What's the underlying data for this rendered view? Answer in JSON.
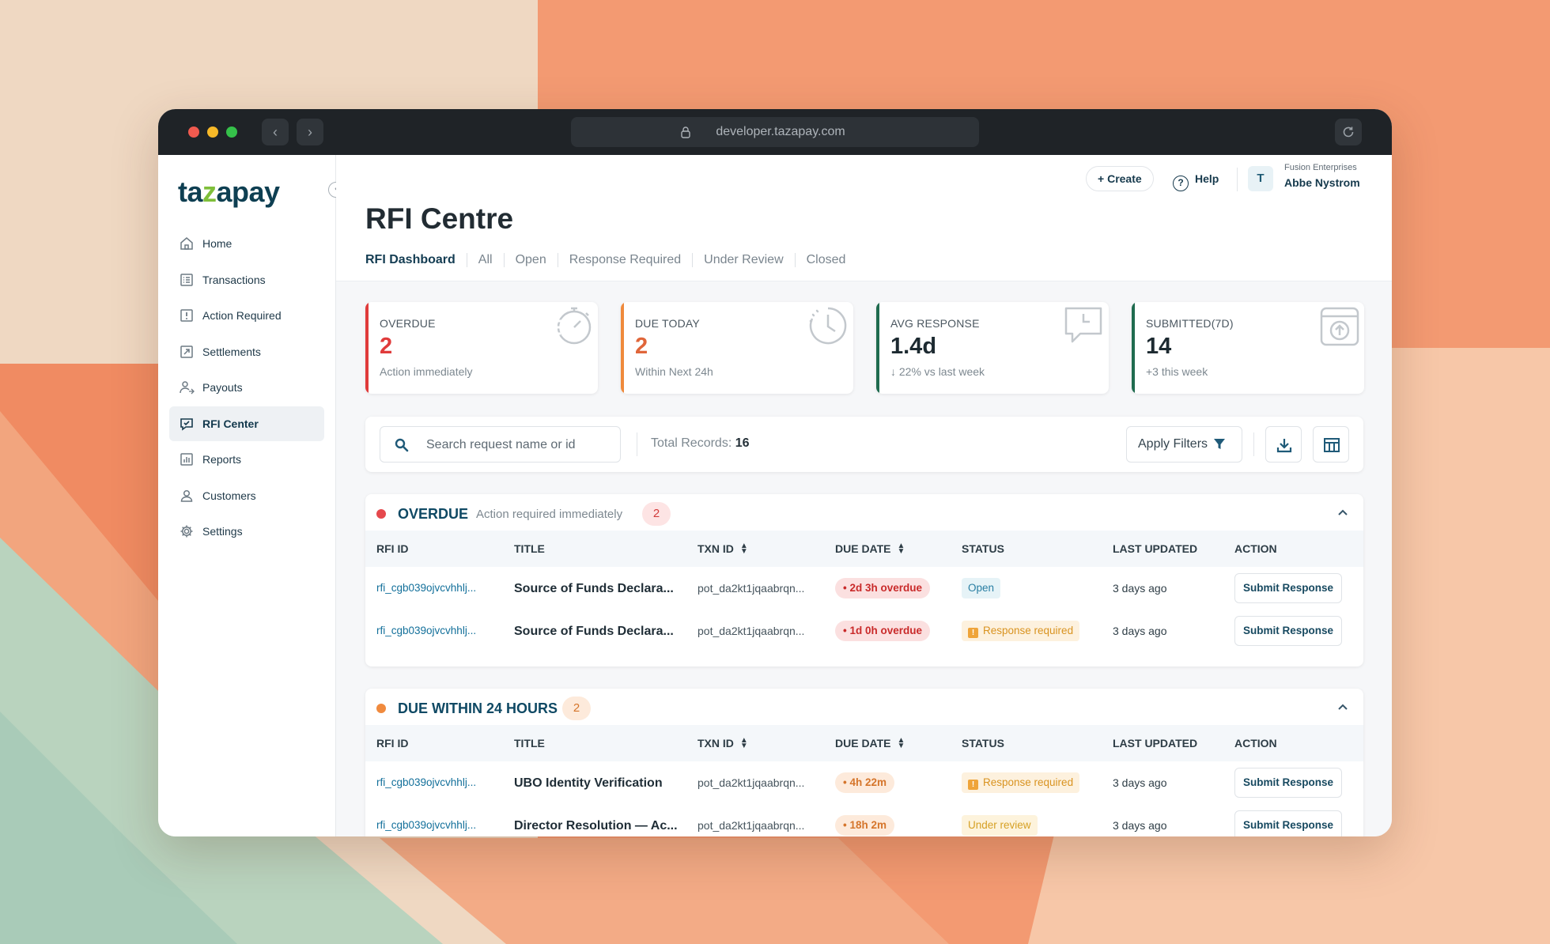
{
  "browser": {
    "url": "developer.tazapay.com"
  },
  "sidebar": {
    "logo": {
      "pre": "ta",
      "z": "z",
      "post": "apay"
    },
    "items": [
      {
        "label": "Home",
        "icon": "home-icon",
        "active": false
      },
      {
        "label": "Transactions",
        "icon": "list-icon",
        "active": false
      },
      {
        "label": "Action Required",
        "icon": "alert-square-icon",
        "active": false
      },
      {
        "label": "Settlements",
        "icon": "arrow-square-icon",
        "active": false
      },
      {
        "label": "Payouts",
        "icon": "user-transfer-icon",
        "active": false
      },
      {
        "label": "RFI Center",
        "icon": "chat-check-icon",
        "active": true
      },
      {
        "label": "Reports",
        "icon": "bar-chart-icon",
        "active": false
      },
      {
        "label": "Customers",
        "icon": "user-icon",
        "active": false
      },
      {
        "label": "Settings",
        "icon": "gear-icon",
        "active": false
      }
    ]
  },
  "topbar": {
    "create_label": "Create",
    "help_label": "Help",
    "avatar_initial": "T",
    "company": "Fusion Enterprises",
    "user": "Abbe Nystrom"
  },
  "page": {
    "title": "RFI Centre",
    "tabs": [
      "RFI Dashboard",
      "All",
      "Open",
      "Response Required",
      "Under Review",
      "Closed"
    ]
  },
  "kpis": [
    {
      "label": "OVERDUE",
      "value": "2",
      "sub": "Action immediately",
      "color": "#e03b3b",
      "icon": "stopwatch-icon"
    },
    {
      "label": "DUE TODAY",
      "value": "2",
      "sub": "Within Next 24h",
      "color": "#ef8a3c",
      "icon": "clock-icon"
    },
    {
      "label": "AVG RESPONSE",
      "value": "1.4d",
      "sub": "22% vs last week",
      "color": "#1f6b4f",
      "icon": "message-clock-icon"
    },
    {
      "label": "SUBMITTED(7D)",
      "value": "14",
      "sub": "+3 this week",
      "color": "#1f6b4f",
      "icon": "upload-box-icon"
    }
  ],
  "toolbar": {
    "search_placeholder": "Search request name or id",
    "total_label": "Total Records:",
    "total_value": "16",
    "apply_label": "Apply Filters"
  },
  "columns": [
    "RFI ID",
    "TITLE",
    "TXN ID",
    "DUE DATE",
    "STATUS",
    "LAST UPDATED",
    "ACTION"
  ],
  "sections": [
    {
      "title": "OVERDUE",
      "subtitle": "Action required immediately",
      "count": "2",
      "dot_color": "#e5484d",
      "rows": [
        {
          "id": "rfi_cgb039ojvcvhhlj...",
          "title": "Source of Funds Declara...",
          "txn": "pot_da2kt1jqaabrqn...",
          "due": "• 2d 3h overdue",
          "status": "Open",
          "status_kind": "open",
          "updated": "3 days ago",
          "action": "Submit Response"
        },
        {
          "id": "rfi_cgb039ojvcvhhlj...",
          "title": "Source of Funds Declara...",
          "txn": "pot_da2kt1jqaabrqn...",
          "due": "• 1d 0h overdue",
          "status": "Response required",
          "status_kind": "resp",
          "updated": "3 days ago",
          "action": "Submit Response"
        }
      ]
    },
    {
      "title": "DUE WITHIN 24 HOURS",
      "subtitle": "",
      "count": "2",
      "dot_color": "#f08a3e",
      "rows": [
        {
          "id": "rfi_cgb039ojvcvhhlj...",
          "title": "UBO Identity Verification",
          "txn": "pot_da2kt1jqaabrqn...",
          "due": "• 4h 22m",
          "status": "Response required",
          "status_kind": "resp",
          "updated": "3 days ago",
          "action": "Submit Response"
        },
        {
          "id": "rfi_cgb039ojvcvhhlj...",
          "title": "Director Resolution — Ac...",
          "txn": "pot_da2kt1jqaabrqn...",
          "due": "• 18h 2m",
          "status": "Under review",
          "status_kind": "review",
          "updated": "3 days ago",
          "action": "Submit Response"
        }
      ]
    }
  ]
}
